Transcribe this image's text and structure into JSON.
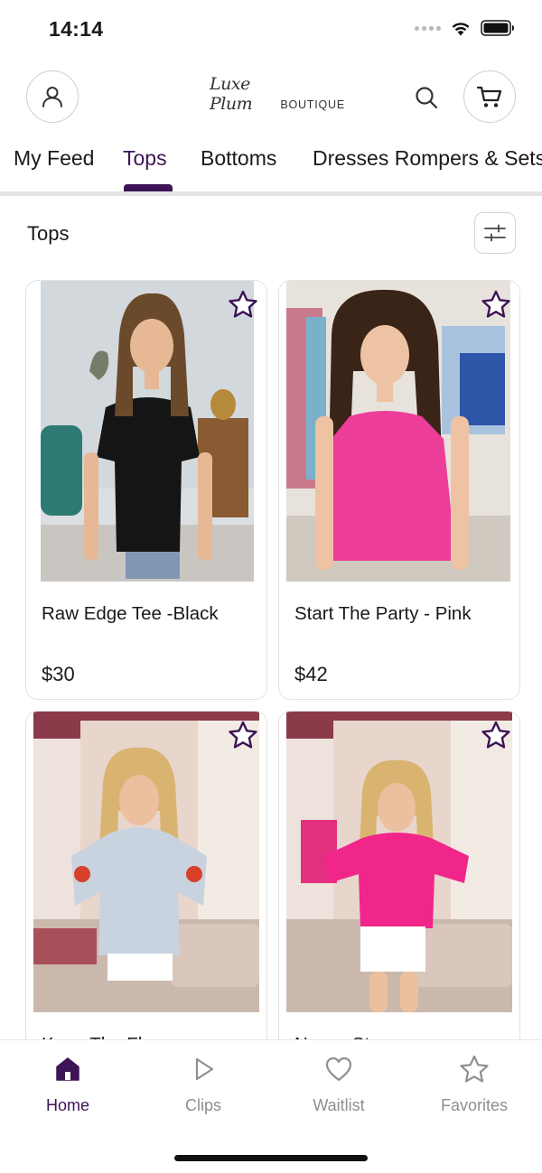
{
  "status_bar": {
    "time": "14:14",
    "icons": [
      "signal-icon",
      "wifi-icon",
      "battery-icon"
    ]
  },
  "header": {
    "logo_script": "Luxe Plum",
    "logo_block": "BOUTIQUE",
    "icons": [
      "account-icon",
      "search-icon",
      "cart-icon"
    ]
  },
  "tabs": [
    {
      "label": "My Feed",
      "active": false
    },
    {
      "label": "Tops",
      "active": true
    },
    {
      "label": "Bottoms",
      "active": false
    },
    {
      "label": "Dresses Rompers & Sets",
      "active": false
    }
  ],
  "section": {
    "title": "Tops",
    "filter_icon": "sliders-icon"
  },
  "products": [
    {
      "name": "Raw Edge Tee -Black",
      "price": "$30",
      "favorite_icon": "star-outline-icon"
    },
    {
      "name": "Start The Party - Pink",
      "price": "$42",
      "favorite_icon": "star-outline-icon"
    },
    {
      "name": "Keep The Flow...",
      "price": "",
      "favorite_icon": "star-outline-icon"
    },
    {
      "name": "Now a Sta...",
      "price": "",
      "favorite_icon": "star-outline-icon"
    }
  ],
  "bottom_nav": [
    {
      "label": "Home",
      "icon": "home-icon",
      "active": true
    },
    {
      "label": "Clips",
      "icon": "play-icon",
      "active": false
    },
    {
      "label": "Waitlist",
      "icon": "heart-icon",
      "active": false
    },
    {
      "label": "Favorites",
      "icon": "star-icon",
      "active": false
    }
  ],
  "colors": {
    "accent": "#3d1456",
    "inactive": "#8e8e93",
    "divider": "#e3e4e6"
  }
}
